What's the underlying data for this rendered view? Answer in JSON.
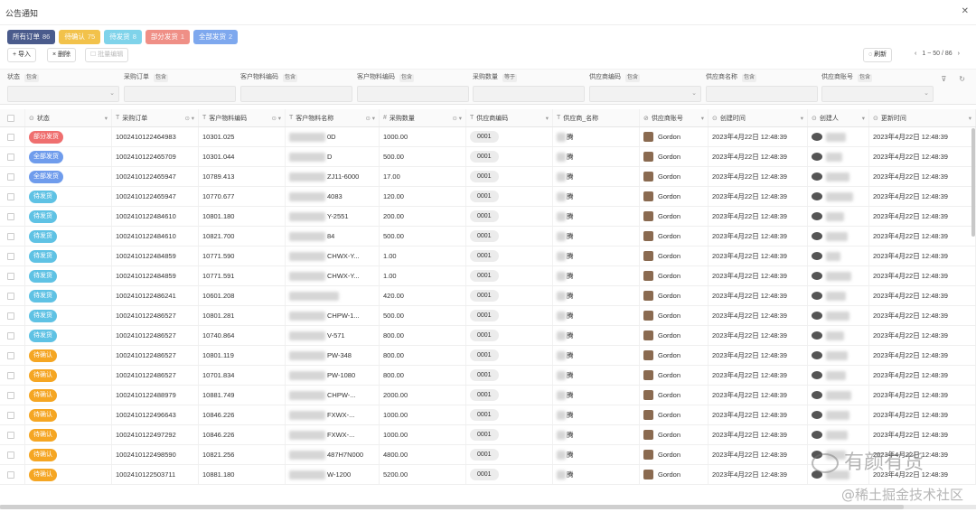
{
  "window": {
    "title": "公告通知"
  },
  "tabs": [
    {
      "label": "所有订单",
      "count": "86",
      "color": "#4a5b8c"
    },
    {
      "label": "待确认",
      "count": "75",
      "color": "#f2c24b"
    },
    {
      "label": "待发货",
      "count": "8",
      "color": "#7fd3ea"
    },
    {
      "label": "部分发货",
      "count": "1",
      "color": "#ef8f86"
    },
    {
      "label": "全部发货",
      "count": "2",
      "color": "#7ea8ee"
    }
  ],
  "toolbar": {
    "import": "导入",
    "delete": "删除",
    "batch_edit": "批量编辑",
    "refresh": "刷新",
    "pager": "1 ~ 50 / 86"
  },
  "filters": [
    {
      "label": "状态",
      "tag": "包含",
      "dropdown": true
    },
    {
      "label": "采购订单",
      "tag": "包含",
      "dropdown": false
    },
    {
      "label": "客户物料编码",
      "tag": "包含",
      "dropdown": false
    },
    {
      "label": "客户物料编码",
      "tag": "包含",
      "dropdown": false
    },
    {
      "label": "采购数量",
      "tag": "等于",
      "dropdown": false
    },
    {
      "label": "供应商编码",
      "tag": "包含",
      "dropdown": true
    },
    {
      "label": "供应商名称",
      "tag": "包含",
      "dropdown": false
    },
    {
      "label": "供应商账号",
      "tag": "包含",
      "dropdown": true
    }
  ],
  "columns": [
    {
      "label": "状态",
      "pre": "⊙",
      "sfx": "▾"
    },
    {
      "label": "采购订单",
      "pre": "T",
      "sfx": "⊙ ▾"
    },
    {
      "label": "客户物料编码",
      "pre": "T",
      "sfx": "⊙ ▾"
    },
    {
      "label": "客户物料名称",
      "pre": "T",
      "sfx": "⊙ ▾"
    },
    {
      "label": "采购数量",
      "pre": "#",
      "sfx": "⊙ ▾"
    },
    {
      "label": "供应商编码",
      "pre": "T",
      "sfx": "▾"
    },
    {
      "label": "供应商_名称",
      "pre": "T",
      "sfx": ""
    },
    {
      "label": "供应商账号",
      "pre": "⊘",
      "sfx": "▾"
    },
    {
      "label": "创建时间",
      "pre": "⊙",
      "sfx": "▾"
    },
    {
      "label": "创建人",
      "pre": "⊙",
      "sfx": "▾"
    },
    {
      "label": "更新时间",
      "pre": "⊙",
      "sfx": "▾"
    }
  ],
  "status_colors": {
    "部分发货": "#ef6f6f",
    "全部发货": "#6f9cec",
    "待发货": "#5fc2e4",
    "待确认": "#f5a623"
  },
  "rows": [
    {
      "status": "部分发货",
      "po": "1002410122464983",
      "code": "10301.025",
      "name": "0D",
      "qty": "1000.00",
      "sup": "0001",
      "supname": "腾",
      "acct": "Gordon",
      "created": "2023年4月22日 12:48:39",
      "updated": "2023年4月22日 12:48:39"
    },
    {
      "status": "全部发货",
      "po": "1002410122465709",
      "code": "10301.044",
      "name": "D",
      "qty": "500.00",
      "sup": "0001",
      "supname": "腾",
      "acct": "Gordon",
      "created": "2023年4月22日 12:48:39",
      "updated": "2023年4月22日 12:48:39"
    },
    {
      "status": "全部发货",
      "po": "1002410122465947",
      "code": "10789.413",
      "name": "ZJ11-6000",
      "qty": "17.00",
      "sup": "0001",
      "supname": "腾",
      "acct": "Gordon",
      "created": "2023年4月22日 12:48:39",
      "updated": "2023年4月22日 12:48:39"
    },
    {
      "status": "待发货",
      "po": "1002410122465947",
      "code": "10770.677",
      "name": "4083",
      "qty": "120.00",
      "sup": "0001",
      "supname": "腾",
      "acct": "Gordon",
      "created": "2023年4月22日 12:48:39",
      "updated": "2023年4月22日 12:48:39"
    },
    {
      "status": "待发货",
      "po": "1002410122484610",
      "code": "10801.180",
      "name": "Y-2551",
      "qty": "200.00",
      "sup": "0001",
      "supname": "腾",
      "acct": "Gordon",
      "created": "2023年4月22日 12:48:39",
      "updated": "2023年4月22日 12:48:39"
    },
    {
      "status": "待发货",
      "po": "1002410122484610",
      "code": "10821.700",
      "name": "84",
      "qty": "500.00",
      "sup": "0001",
      "supname": "腾",
      "acct": "Gordon",
      "created": "2023年4月22日 12:48:39",
      "updated": "2023年4月22日 12:48:39"
    },
    {
      "status": "待发货",
      "po": "1002410122484859",
      "code": "10771.590",
      "name": "CHWX-Y...",
      "qty": "1.00",
      "sup": "0001",
      "supname": "腾",
      "acct": "Gordon",
      "created": "2023年4月22日 12:48:39",
      "updated": "2023年4月22日 12:48:39"
    },
    {
      "status": "待发货",
      "po": "1002410122484859",
      "code": "10771.591",
      "name": "CHWX-Y...",
      "qty": "1.00",
      "sup": "0001",
      "supname": "腾",
      "acct": "Gordon",
      "created": "2023年4月22日 12:48:39",
      "updated": "2023年4月22日 12:48:39"
    },
    {
      "status": "待发货",
      "po": "1002410122486241",
      "code": "10601.208",
      "name": "",
      "qty": "420.00",
      "sup": "0001",
      "supname": "腾",
      "acct": "Gordon",
      "created": "2023年4月22日 12:48:39",
      "updated": "2023年4月22日 12:48:39"
    },
    {
      "status": "待发货",
      "po": "1002410122486527",
      "code": "10801.281",
      "name": "CHPW-1...",
      "qty": "500.00",
      "sup": "0001",
      "supname": "腾",
      "acct": "Gordon",
      "created": "2023年4月22日 12:48:39",
      "updated": "2023年4月22日 12:48:39"
    },
    {
      "status": "待发货",
      "po": "1002410122486527",
      "code": "10740.864",
      "name": "V-571",
      "qty": "800.00",
      "sup": "0001",
      "supname": "腾",
      "acct": "Gordon",
      "created": "2023年4月22日 12:48:39",
      "updated": "2023年4月22日 12:48:39"
    },
    {
      "status": "待确认",
      "po": "1002410122486527",
      "code": "10801.119",
      "name": "PW-348",
      "qty": "800.00",
      "sup": "0001",
      "supname": "腾",
      "acct": "Gordon",
      "created": "2023年4月22日 12:48:39",
      "updated": "2023年4月22日 12:48:39"
    },
    {
      "status": "待确认",
      "po": "1002410122486527",
      "code": "10701.834",
      "name": "PW-1080",
      "qty": "800.00",
      "sup": "0001",
      "supname": "腾",
      "acct": "Gordon",
      "created": "2023年4月22日 12:48:39",
      "updated": "2023年4月22日 12:48:39"
    },
    {
      "status": "待确认",
      "po": "1002410122488979",
      "code": "10881.749",
      "name": "CHPW-...",
      "qty": "2000.00",
      "sup": "0001",
      "supname": "腾",
      "acct": "Gordon",
      "created": "2023年4月22日 12:48:39",
      "updated": "2023年4月22日 12:48:39"
    },
    {
      "status": "待确认",
      "po": "1002410122496643",
      "code": "10846.226",
      "name": "FXWX-...",
      "qty": "1000.00",
      "sup": "0001",
      "supname": "腾",
      "acct": "Gordon",
      "created": "2023年4月22日 12:48:39",
      "updated": "2023年4月22日 12:48:39"
    },
    {
      "status": "待确认",
      "po": "1002410122497292",
      "code": "10846.226",
      "name": "FXWX-...",
      "qty": "1000.00",
      "sup": "0001",
      "supname": "腾",
      "acct": "Gordon",
      "created": "2023年4月22日 12:48:39",
      "updated": "2023年4月22日 12:48:39"
    },
    {
      "status": "待确认",
      "po": "1002410122498590",
      "code": "10821.256",
      "name": "487H7N000",
      "qty": "4800.00",
      "sup": "0001",
      "supname": "腾",
      "acct": "Gordon",
      "created": "2023年4月22日 12:48:39",
      "updated": "2023年4月22日 12:48:39"
    },
    {
      "status": "待确认",
      "po": "1002410122503711",
      "code": "10881.180",
      "name": "W-1200",
      "qty": "5200.00",
      "sup": "0001",
      "supname": "腾",
      "acct": "Gordon",
      "created": "2023年4月22日 12:48:39",
      "updated": "2023年4月22日 12:48:39"
    }
  ],
  "watermark": {
    "line1": "有颜有货",
    "line2": "@稀土掘金技术社区"
  }
}
